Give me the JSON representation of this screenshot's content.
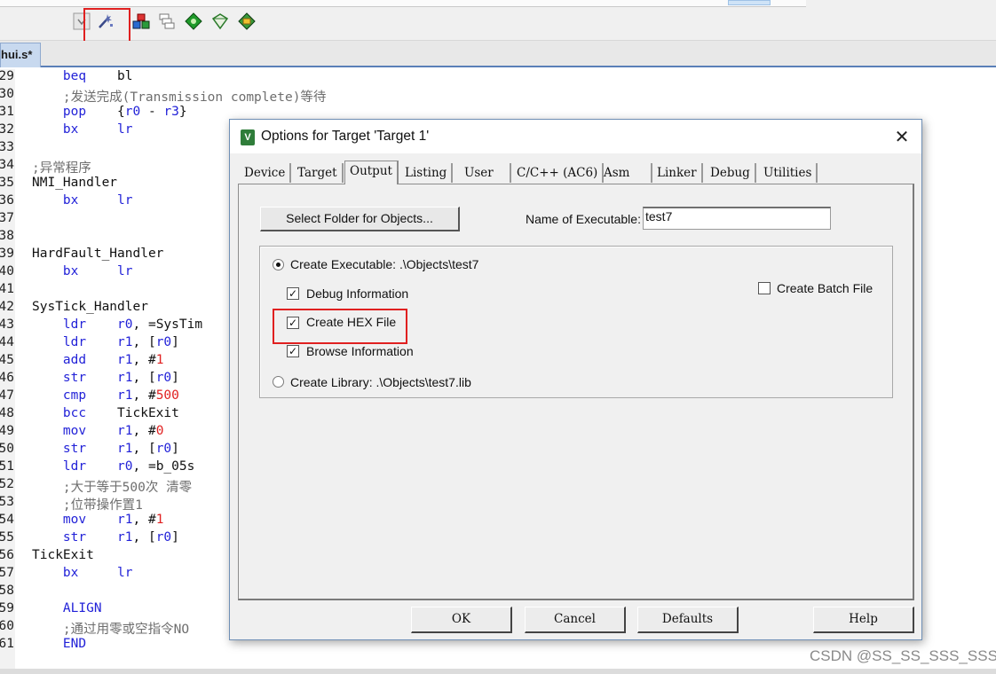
{
  "editor": {
    "file_tab": "hui.s*",
    "lines": [
      {
        "num": "29",
        "segs": [
          {
            "c": "kw",
            "t": "    beq"
          },
          {
            "c": "sy",
            "t": "    bl"
          }
        ]
      },
      {
        "num": "30",
        "segs": [
          {
            "c": "cm",
            "t": "    ;发送完成(Transmission complete)等待"
          }
        ]
      },
      {
        "num": "31",
        "segs": [
          {
            "c": "kw",
            "t": "    pop"
          },
          {
            "c": "sy",
            "t": "    {"
          },
          {
            "c": "kw",
            "t": "r0"
          },
          {
            "c": "sy",
            "t": " - "
          },
          {
            "c": "kw",
            "t": "r3"
          },
          {
            "c": "sy",
            "t": "}"
          }
        ]
      },
      {
        "num": "32",
        "segs": [
          {
            "c": "kw",
            "t": "    bx"
          },
          {
            "c": "kw",
            "t": "     lr"
          }
        ]
      },
      {
        "num": "33",
        "segs": []
      },
      {
        "num": "34",
        "segs": [
          {
            "c": "cm",
            "t": ";异常程序"
          }
        ]
      },
      {
        "num": "35",
        "segs": [
          {
            "c": "sy",
            "t": "NMI_Handler"
          }
        ]
      },
      {
        "num": "36",
        "segs": [
          {
            "c": "kw",
            "t": "    bx"
          },
          {
            "c": "kw",
            "t": "     lr"
          }
        ]
      },
      {
        "num": "37",
        "segs": []
      },
      {
        "num": "38",
        "segs": []
      },
      {
        "num": "39",
        "segs": [
          {
            "c": "sy",
            "t": "HardFault_Handler"
          }
        ]
      },
      {
        "num": "40",
        "segs": [
          {
            "c": "kw",
            "t": "    bx"
          },
          {
            "c": "kw",
            "t": "     lr"
          }
        ]
      },
      {
        "num": "41",
        "segs": []
      },
      {
        "num": "42",
        "segs": [
          {
            "c": "sy",
            "t": "SysTick_Handler"
          }
        ]
      },
      {
        "num": "43",
        "segs": [
          {
            "c": "kw",
            "t": "    ldr"
          },
          {
            "c": "kw",
            "t": "    r0"
          },
          {
            "c": "sy",
            "t": ", =SysTim"
          }
        ]
      },
      {
        "num": "44",
        "segs": [
          {
            "c": "kw",
            "t": "    ldr"
          },
          {
            "c": "kw",
            "t": "    r1"
          },
          {
            "c": "sy",
            "t": ", ["
          },
          {
            "c": "kw",
            "t": "r0"
          },
          {
            "c": "sy",
            "t": "]"
          }
        ]
      },
      {
        "num": "45",
        "segs": [
          {
            "c": "kw",
            "t": "    add"
          },
          {
            "c": "kw",
            "t": "    r1"
          },
          {
            "c": "sy",
            "t": ", #"
          },
          {
            "c": "nm",
            "t": "1"
          }
        ]
      },
      {
        "num": "46",
        "segs": [
          {
            "c": "kw",
            "t": "    str"
          },
          {
            "c": "kw",
            "t": "    r1"
          },
          {
            "c": "sy",
            "t": ", ["
          },
          {
            "c": "kw",
            "t": "r0"
          },
          {
            "c": "sy",
            "t": "]"
          }
        ]
      },
      {
        "num": "47",
        "segs": [
          {
            "c": "kw",
            "t": "    cmp"
          },
          {
            "c": "kw",
            "t": "    r1"
          },
          {
            "c": "sy",
            "t": ", #"
          },
          {
            "c": "nm",
            "t": "500"
          }
        ]
      },
      {
        "num": "48",
        "segs": [
          {
            "c": "kw",
            "t": "    bcc"
          },
          {
            "c": "sy",
            "t": "    TickExit"
          }
        ]
      },
      {
        "num": "49",
        "segs": [
          {
            "c": "kw",
            "t": "    mov"
          },
          {
            "c": "kw",
            "t": "    r1"
          },
          {
            "c": "sy",
            "t": ", #"
          },
          {
            "c": "nm",
            "t": "0"
          }
        ]
      },
      {
        "num": "50",
        "segs": [
          {
            "c": "kw",
            "t": "    str"
          },
          {
            "c": "kw",
            "t": "    r1"
          },
          {
            "c": "sy",
            "t": ", ["
          },
          {
            "c": "kw",
            "t": "r0"
          },
          {
            "c": "sy",
            "t": "]"
          }
        ]
      },
      {
        "num": "51",
        "segs": [
          {
            "c": "kw",
            "t": "    ldr"
          },
          {
            "c": "kw",
            "t": "    r0"
          },
          {
            "c": "sy",
            "t": ", =b_05s"
          }
        ]
      },
      {
        "num": "52",
        "segs": [
          {
            "c": "cm",
            "t": "    ;大于等于500次 清零"
          }
        ]
      },
      {
        "num": "53",
        "segs": [
          {
            "c": "cm",
            "t": "    ;位带操作置1"
          }
        ]
      },
      {
        "num": "54",
        "segs": [
          {
            "c": "kw",
            "t": "    mov"
          },
          {
            "c": "kw",
            "t": "    r1"
          },
          {
            "c": "sy",
            "t": ", #"
          },
          {
            "c": "nm",
            "t": "1"
          }
        ]
      },
      {
        "num": "55",
        "segs": [
          {
            "c": "kw",
            "t": "    str"
          },
          {
            "c": "kw",
            "t": "    r1"
          },
          {
            "c": "sy",
            "t": ", ["
          },
          {
            "c": "kw",
            "t": "r0"
          },
          {
            "c": "sy",
            "t": "]"
          }
        ]
      },
      {
        "num": "56",
        "segs": [
          {
            "c": "sy",
            "t": "TickExit"
          }
        ]
      },
      {
        "num": "57",
        "segs": [
          {
            "c": "kw",
            "t": "    bx"
          },
          {
            "c": "kw",
            "t": "     lr"
          }
        ]
      },
      {
        "num": "58",
        "segs": []
      },
      {
        "num": "59",
        "segs": [
          {
            "c": "kw",
            "t": "    ALIGN"
          }
        ]
      },
      {
        "num": "60",
        "segs": [
          {
            "c": "cm",
            "t": "    ;通过用零或空指令NO"
          }
        ]
      },
      {
        "num": "61",
        "segs": [
          {
            "c": "kw",
            "t": "    END"
          }
        ]
      }
    ]
  },
  "toolbar": {
    "icons": [
      "dropdown-icon",
      "magic-wand-icon",
      "component-icon",
      "stack-icon",
      "diamond-green-icon",
      "diamond-outline-icon",
      "pack-installer-icon"
    ]
  },
  "dialog": {
    "title": "Options for Target 'Target 1'",
    "tabs": [
      "Device",
      "Target",
      "Output",
      "Listing",
      "User",
      "C/C++ (AC6)",
      "Asm",
      "Linker",
      "Debug",
      "Utilities"
    ],
    "active_tab": "Output",
    "select_folder_button": "Select Folder for Objects...",
    "name_of_executable_label": "Name of Executable:",
    "name_of_executable_value": "test7",
    "create_executable_label": "Create Executable:  .\\Objects\\test7",
    "create_executable_selected": true,
    "debug_information_label": "Debug Information",
    "debug_information_checked": true,
    "create_hex_file_label": "Create HEX File",
    "create_hex_file_checked": true,
    "browse_information_label": "Browse Information",
    "browse_information_checked": true,
    "create_batch_file_label": "Create Batch File",
    "create_batch_file_checked": false,
    "create_library_label": "Create Library:  .\\Objects\\test7.lib",
    "create_library_selected": false,
    "buttons": {
      "ok": "OK",
      "cancel": "Cancel",
      "defaults": "Defaults",
      "help": "Help"
    }
  },
  "watermark": "CSDN @SS_SS_SSS_SSS",
  "colors": {
    "highlight": "#e02020",
    "keyword": "#2222d8",
    "comment": "#6e6e6e",
    "number": "#e02020"
  }
}
